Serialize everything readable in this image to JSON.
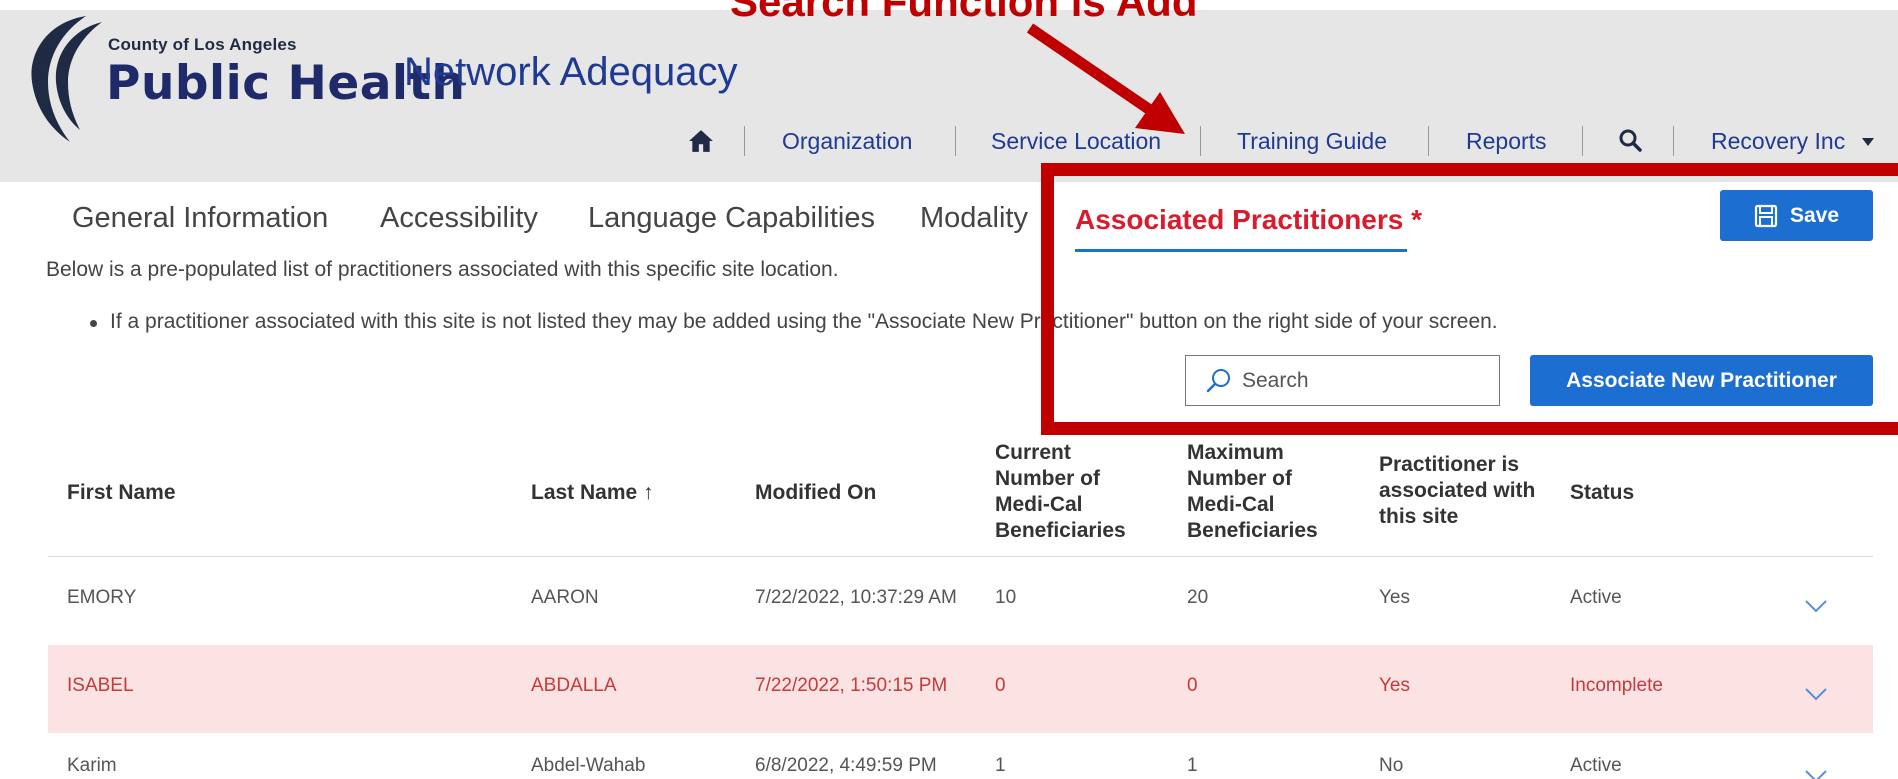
{
  "header": {
    "annotation_text": "Search Function is Add",
    "county_name": "County of Los Angeles",
    "org_name": "Public Health",
    "app_title": "Network Adequacy",
    "nav": [
      {
        "label": "Organization"
      },
      {
        "label": "Service Location"
      },
      {
        "label": "Training Guide"
      },
      {
        "label": "Reports"
      }
    ],
    "user_menu": "Recovery Inc",
    "icons": [
      "home-icon",
      "search-icon",
      "caret-down-icon"
    ]
  },
  "tabs": [
    {
      "label": "General Information"
    },
    {
      "label": "Accessibility"
    },
    {
      "label": "Language Capabilities"
    },
    {
      "label": "Modality"
    },
    {
      "label": "Associated Practitioners *",
      "active": true
    }
  ],
  "toolbar": {
    "save_label": "Save",
    "search_placeholder": "Search",
    "associate_label": "Associate New Practitioner"
  },
  "content": {
    "intro": "Below is a pre-populated list of practitioners associated with this specific site location.",
    "bullet": "If a practitioner associated with this site is not listed they may be added using the \"Associate New Practitioner\" button on the right side of your screen."
  },
  "table": {
    "columns": [
      "First Name",
      "Last Name ↑",
      "Modified On",
      "Current Number of Medi-Cal Beneficiaries",
      "Maximum Number of Medi-Cal Beneficiaries",
      "Practitioner is associated with this site",
      "Status"
    ],
    "rows": [
      {
        "first": "EMORY",
        "last": "AARON",
        "modified": "7/22/2022, 10:37:29 AM",
        "current": "10",
        "maximum": "20",
        "associated": "Yes",
        "status": "Active"
      },
      {
        "first": "ISABEL",
        "last": "ABDALLA",
        "modified": "7/22/2022, 1:50:15 PM",
        "current": "0",
        "maximum": "0",
        "associated": "Yes",
        "status": "Incomplete"
      },
      {
        "first": "Karim",
        "last": "Abdel-Wahab",
        "modified": "6/8/2022, 4:49:59 PM",
        "current": "1",
        "maximum": "1",
        "associated": "No",
        "status": "Active"
      }
    ]
  },
  "colors": {
    "brand_blue": "#1f3a93",
    "button_blue": "#1c6ed0",
    "active_tab_red": "#d81b2d",
    "annotation_red": "#c00000",
    "incomplete_row": "#fbe3e3"
  }
}
